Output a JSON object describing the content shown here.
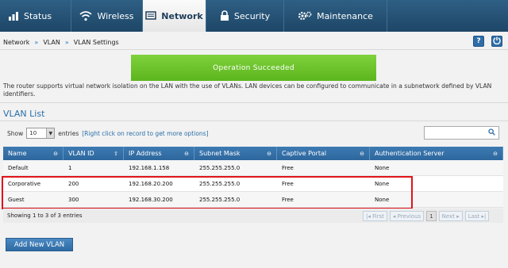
{
  "nav": {
    "tabs": [
      {
        "label": "Status",
        "icon": "status-icon"
      },
      {
        "label": "Wireless",
        "icon": "wireless-icon"
      },
      {
        "label": "Network",
        "icon": "network-icon",
        "active": true
      },
      {
        "label": "Security",
        "icon": "lock-icon"
      },
      {
        "label": "Maintenance",
        "icon": "gear-icon"
      }
    ]
  },
  "breadcrumb": [
    "Network",
    "VLAN",
    "VLAN Settings"
  ],
  "breadcrumb_sep": "»",
  "help_label": "?",
  "banner": "Operation Succeeded",
  "description": "The router supports virtual network isolation on the LAN with the use of VLANs. LAN devices can be configured to communicate in a subnetwork defined by VLAN identifiers.",
  "list_title": "VLAN List",
  "controls": {
    "show_label": "Show",
    "show_value": "10",
    "entries_label": "entries",
    "hint": "[Right click on record to get more options]"
  },
  "table": {
    "headers": [
      "Name",
      "VLAN ID",
      "IP Address",
      "Subnet Mask",
      "Captive Portal",
      "Authentication Server"
    ],
    "rows": [
      [
        "Default",
        "1",
        "192.168.1.158",
        "255.255.255.0",
        "Free",
        "None"
      ],
      [
        "Corporative",
        "200",
        "192.168.20.200",
        "255.255.255.0",
        "Free",
        "None"
      ],
      [
        "Guest",
        "300",
        "192.168.30.200",
        "255.255.255.0",
        "Free",
        "None"
      ]
    ]
  },
  "footer": {
    "summary": "Showing 1 to 3 of 3 entries",
    "first": "First",
    "previous": "Previous",
    "page": "1",
    "next": "Next",
    "last": "Last"
  },
  "add_button": "Add New VLAN",
  "colors": {
    "nav": "#1e4667",
    "banner": "#6cc42b",
    "accent": "#2f6ea7",
    "highlight": "#e0141a"
  }
}
